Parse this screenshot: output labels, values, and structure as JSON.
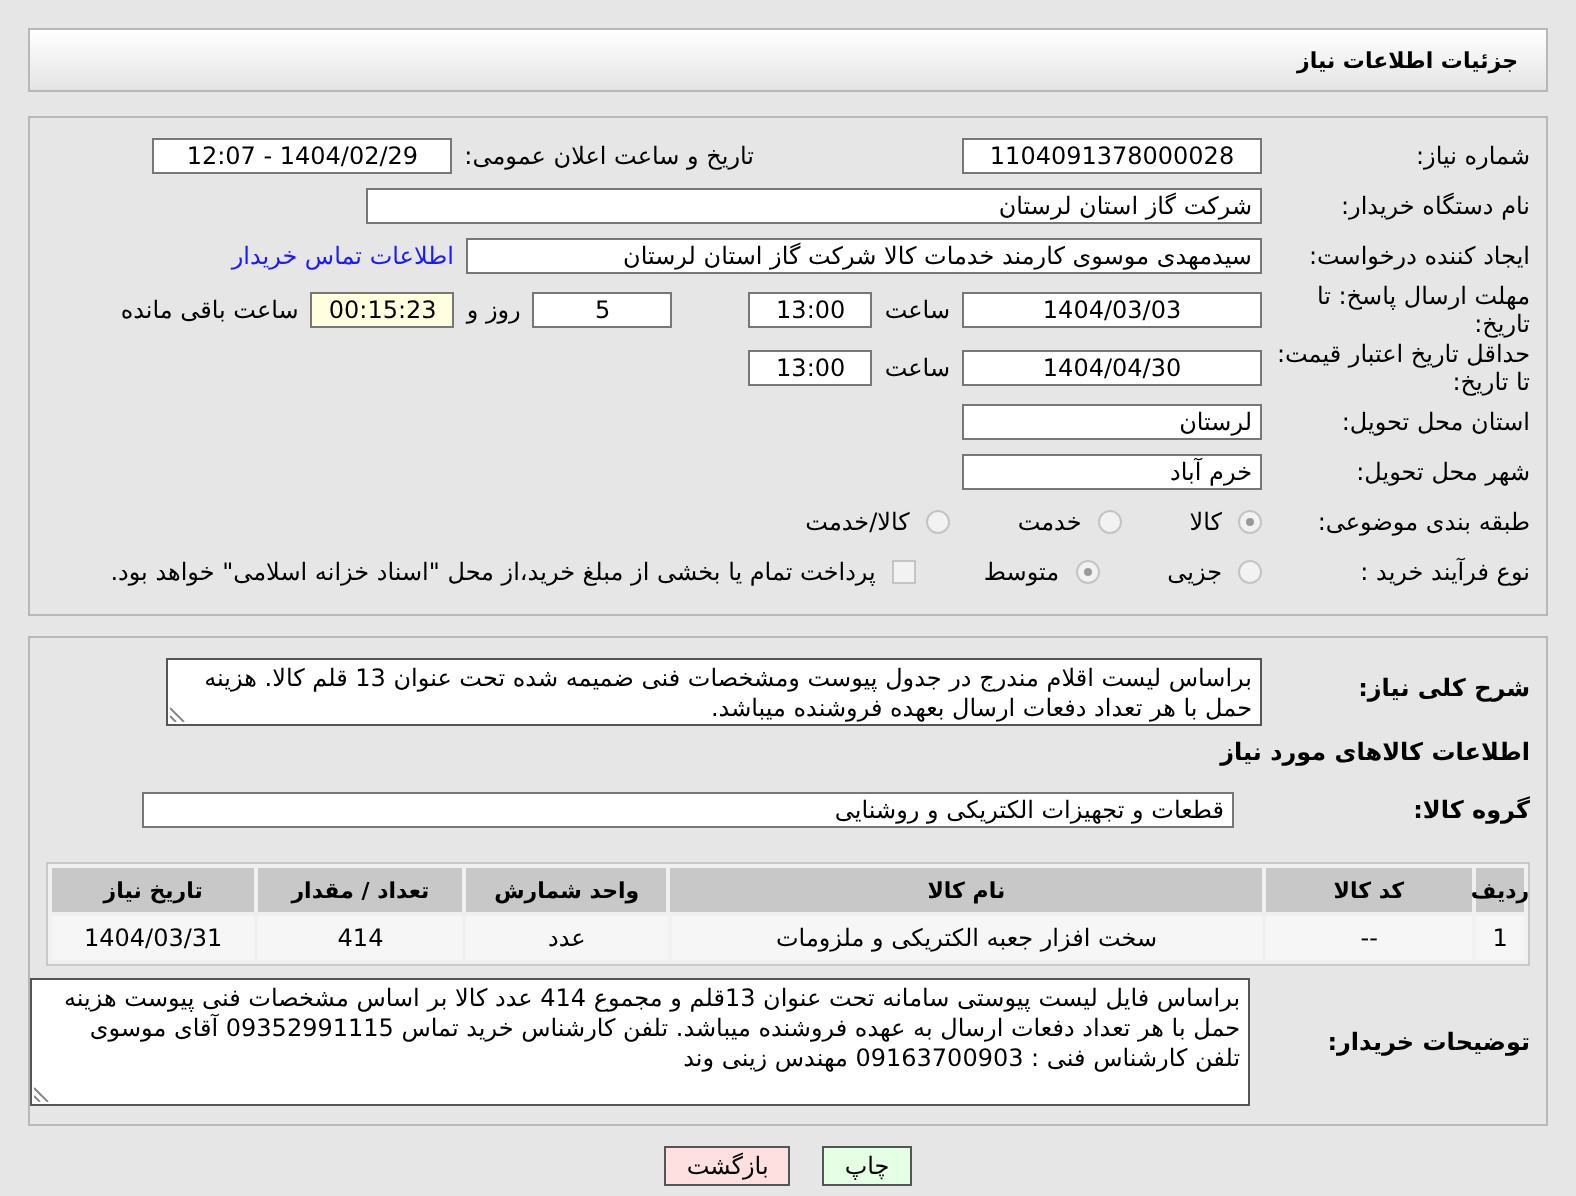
{
  "page_title": "جزئیات اطلاعات نیاز",
  "need_number": {
    "label": "شماره نیاز:",
    "value": "1104091378000028"
  },
  "announce_datetime": {
    "label": "تاریخ و ساعت اعلان عمومی:",
    "value": "1404/02/29 - 12:07"
  },
  "buyer_org": {
    "label": "نام دستگاه خریدار:",
    "value": "شرکت گاز استان لرستان"
  },
  "requester": {
    "label": "ایجاد کننده درخواست:",
    "value": "سیدمهدی موسوی کارمند خدمات کالا شرکت گاز استان لرستان",
    "link": "اطلاعات تماس خریدار"
  },
  "response_deadline": {
    "label": "مهلت ارسال پاسخ: تا تاریخ:",
    "date": "1404/03/03",
    "time_label": "ساعت",
    "time": "13:00",
    "days": "5",
    "days_label": "روز و",
    "remaining": "00:15:23",
    "remaining_label": "ساعت باقی مانده"
  },
  "price_validity": {
    "label": "حداقل تاریخ اعتبار قیمت: تا تاریخ:",
    "date": "1404/04/30",
    "time_label": "ساعت",
    "time": "13:00"
  },
  "delivery_province": {
    "label": "استان محل تحویل:",
    "value": "لرستان"
  },
  "delivery_city": {
    "label": "شهر محل تحویل:",
    "value": "خرم آباد"
  },
  "subject_category": {
    "label": "طبقه بندی موضوعی:",
    "options": [
      {
        "label": "کالا",
        "selected": true
      },
      {
        "label": "خدمت",
        "selected": false
      },
      {
        "label": "کالا/خدمت",
        "selected": false
      }
    ]
  },
  "purchase_process": {
    "label": "نوع فرآیند خرید :",
    "options": [
      {
        "label": "جزیی",
        "selected": false
      },
      {
        "label": "متوسط",
        "selected": true
      }
    ],
    "payment": {
      "checked": false,
      "label": "پرداخت تمام یا بخشی از مبلغ خرید،از محل \"اسناد خزانه اسلامی\" خواهد بود."
    }
  },
  "general_description": {
    "label": "شرح کلی نیاز:",
    "value": "براساس لیست اقلام مندرج در جدول پیوست ومشخصات فنی ضمیمه شده تحت عنوان 13 قلم کالا. هزینه حمل با هر تعداد دفعات ارسال بعهده فروشنده میباشد."
  },
  "items_section": {
    "title": "اطلاعات کالاهای مورد نیاز",
    "group_label": "گروه کالا:",
    "group": "قطعات و تجهیزات الکتریکی و روشنایی",
    "table": {
      "columns": [
        "ردیف",
        "کد کالا",
        "نام کالا",
        "واحد شمارش",
        "تعداد / مقدار",
        "تاریخ نیاز"
      ],
      "rows": [
        [
          "1",
          "--",
          "سخت افزار جعبه الکتریکی و ملزومات",
          "عدد",
          "414",
          "1404/03/31"
        ]
      ]
    }
  },
  "buyer_notes": {
    "label": "توضیحات خریدار:",
    "value": "براساس فایل لیست پیوستی سامانه تحت عنوان 13قلم و مجموع 414 عدد کالا بر اساس مشخصات فنی پیوست هزینه حمل با هر تعداد دفعات ارسال به عهده فروشنده میباشد. تلفن کارشناس خرید تماس 09352991115 آقای موسوی تلفن کارشناس فنی : 09163700903 مهندس زینی وند"
  },
  "buttons": [
    {
      "label": "چاپ",
      "kind": "print"
    },
    {
      "label": "بازگشت",
      "kind": "back"
    }
  ]
}
